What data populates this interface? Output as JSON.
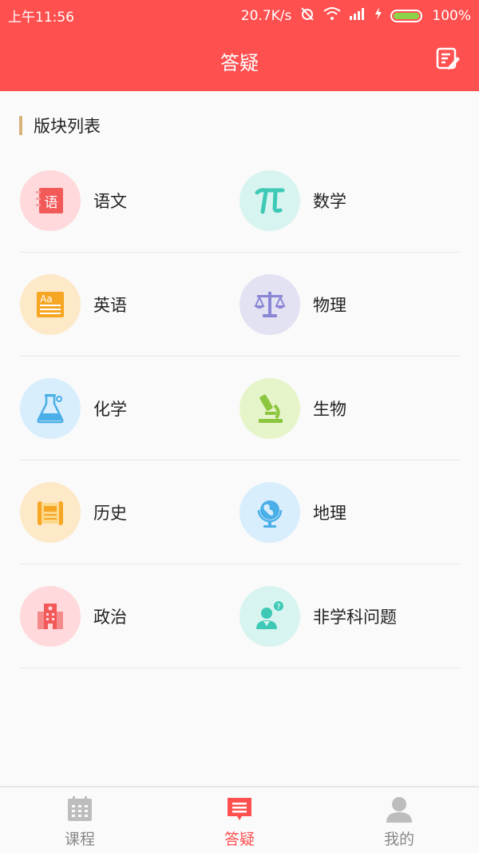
{
  "status_bar": {
    "time": "上午11:56",
    "network_speed": "20.7K/s",
    "battery": "100%"
  },
  "header": {
    "title": "答疑"
  },
  "section": {
    "title": "版块列表"
  },
  "subjects": [
    {
      "label": "语文",
      "icon": "chinese-book-icon",
      "bg": "#ffd9dc"
    },
    {
      "label": "数学",
      "icon": "pi-icon",
      "bg": "#d8f4f0"
    },
    {
      "label": "英语",
      "icon": "english-book-icon",
      "bg": "#fde9c8"
    },
    {
      "label": "物理",
      "icon": "balance-scale-icon",
      "bg": "#e3e2f3"
    },
    {
      "label": "化学",
      "icon": "flask-icon",
      "bg": "#d8eefc"
    },
    {
      "label": "生物",
      "icon": "microscope-icon",
      "bg": "#e6f5c9"
    },
    {
      "label": "历史",
      "icon": "history-scroll-icon",
      "bg": "#fde9c8"
    },
    {
      "label": "地理",
      "icon": "globe-icon",
      "bg": "#d8eefc"
    },
    {
      "label": "政治",
      "icon": "government-building-icon",
      "bg": "#ffd9dc"
    },
    {
      "label": "非学科问题",
      "icon": "person-question-icon",
      "bg": "#d8f4f0"
    }
  ],
  "tabs": [
    {
      "label": "课程",
      "icon": "calendar-icon",
      "active": false
    },
    {
      "label": "答疑",
      "icon": "list-icon",
      "active": true
    },
    {
      "label": "我的",
      "icon": "user-icon",
      "active": false
    }
  ],
  "colors": {
    "accent": "#ff5050",
    "section_bar": "#d7b27a",
    "divider": "#e6e6e6"
  }
}
